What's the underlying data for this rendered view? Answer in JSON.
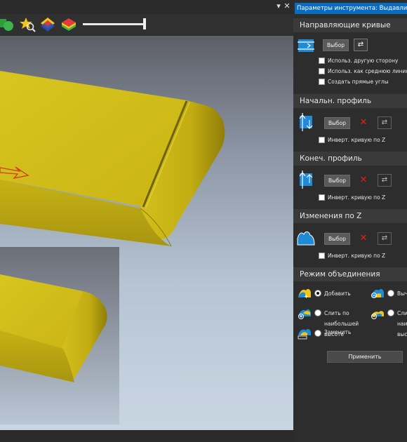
{
  "panel": {
    "title": "Параметры инструмента: Выдавливание",
    "sections": {
      "guide": {
        "title": "Направляющие кривые",
        "select_label": "Выбор",
        "options": [
          "Использ. другую сторону",
          "Использ. как среднюю линию",
          "Создать прямые углы"
        ]
      },
      "start_profile": {
        "title": "Начальн. профиль",
        "select_label": "Выбор",
        "invert_label": "Инверт. кривую по Z"
      },
      "end_profile": {
        "title": "Конеч. профиль",
        "select_label": "Выбор",
        "invert_label": "Инверт. кривую по Z"
      },
      "z_change": {
        "title": "Изменения по Z",
        "select_label": "Выбор",
        "invert_label": "Инверт. кривую по Z"
      },
      "merge_mode": {
        "title": "Режим объединения",
        "options": [
          {
            "label": "Добавить",
            "selected": true
          },
          {
            "label": "Выч",
            "selected": false
          },
          {
            "label": "Слить по",
            "selected": false
          },
          {
            "label": "наибольшей",
            "selected": false
          },
          {
            "label": "высоте",
            "selected": false
          },
          {
            "label": "Сли",
            "selected": false
          },
          {
            "label": "наи",
            "selected": false
          },
          {
            "label": "выс",
            "selected": false
          },
          {
            "label": "Заменить",
            "selected": false
          }
        ]
      }
    },
    "apply_label": "Применить"
  },
  "toolbar": {
    "slider_value": 1.0
  },
  "window_controls": {
    "dropdown": "▾",
    "close": "✕"
  },
  "colors": {
    "accent": "#0b6bbf",
    "model": "#d4c020",
    "panel_bg": "#2d2d2d",
    "delete": "#e0201a"
  }
}
